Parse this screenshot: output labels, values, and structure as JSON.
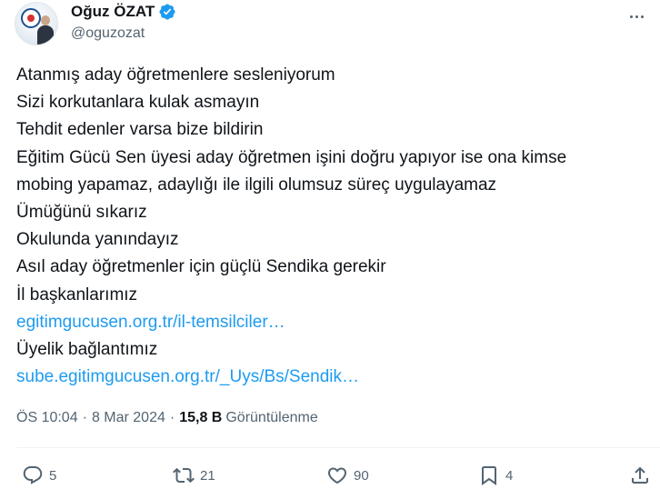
{
  "author": {
    "name": "Oğuz ÖZAT",
    "handle": "@oguzozat",
    "verified": true
  },
  "tweet": {
    "lines": [
      "Atanmış aday öğretmenlere sesleniyorum",
      "Sizi korkutanlara kulak asmayın",
      "Tehdit edenler varsa bize bildirin",
      "Eğitim Gücü Sen üyesi aday öğretmen işini doğru yapıyor ise ona kimse",
      "mobing yapamaz, adaylığı ile ilgili olumsuz süreç uygulayamaz",
      "Ümüğünü sıkarız",
      "Okulunda yanındayız",
      "Asıl aday öğretmenler için güçlü Sendika gerekir",
      "İl başkanlarımız"
    ],
    "link1": "egitimgucusen.org.tr/il-temsilciler…",
    "line_after_link1": "Üyelik bağlantımız",
    "link2": "sube.egitimgucusen.org.tr/_Uys/Bs/Sendik…"
  },
  "meta": {
    "time": "ÖS 10:04",
    "separator": "·",
    "date": "8 Mar 2024",
    "views_count": "15,8 B",
    "views_label": "Görüntülenme"
  },
  "actions": {
    "replies": "5",
    "reposts": "21",
    "likes": "90",
    "bookmarks": "4"
  },
  "colors": {
    "text": "#0f1419",
    "secondary": "#536471",
    "link": "#1d9bf0",
    "verified": "#1d9bf0"
  },
  "icons": [
    "more-icon",
    "verified-badge-icon",
    "reply-icon",
    "repost-icon",
    "like-icon",
    "bookmark-icon",
    "share-icon"
  ]
}
